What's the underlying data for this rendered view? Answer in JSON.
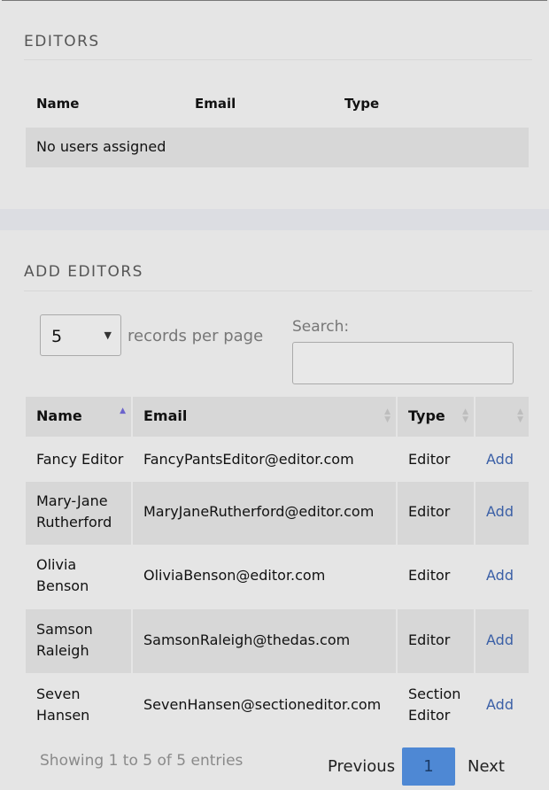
{
  "editors": {
    "title": "EDITORS",
    "columns": [
      "Name",
      "Email",
      "Type"
    ],
    "empty_text": "No users assigned"
  },
  "add_editors": {
    "title": "ADD EDITORS",
    "page_size": "5",
    "records_per_page_label": "records per page",
    "search_label": "Search:",
    "search_value": "",
    "columns": [
      "Name",
      "Email",
      "Type"
    ],
    "rows": [
      {
        "name": "Fancy Editor",
        "email": "FancyPantsEditor@editor.com",
        "type": "Editor",
        "action": "Add"
      },
      {
        "name": "Mary-Jane Rutherford",
        "email": "MaryJaneRutherford@editor.com",
        "type": "Editor",
        "action": "Add"
      },
      {
        "name": "Olivia Benson",
        "email": "OliviaBenson@editor.com",
        "type": "Editor",
        "action": "Add"
      },
      {
        "name": "Samson Raleigh",
        "email": "SamsonRaleigh@thedas.com",
        "type": "Editor",
        "action": "Add"
      },
      {
        "name": "Seven Hansen",
        "email": "SevenHansen@sectioneditor.com",
        "type": "Section Editor",
        "action": "Add"
      }
    ],
    "info": "Showing 1 to 5 of 5 entries",
    "pagination": {
      "previous": "Previous",
      "current": "1",
      "next": "Next"
    }
  },
  "colors": {
    "link": "#3a5fa6",
    "active_page": "#4e88d4",
    "sort_active": "#6b63cc"
  }
}
